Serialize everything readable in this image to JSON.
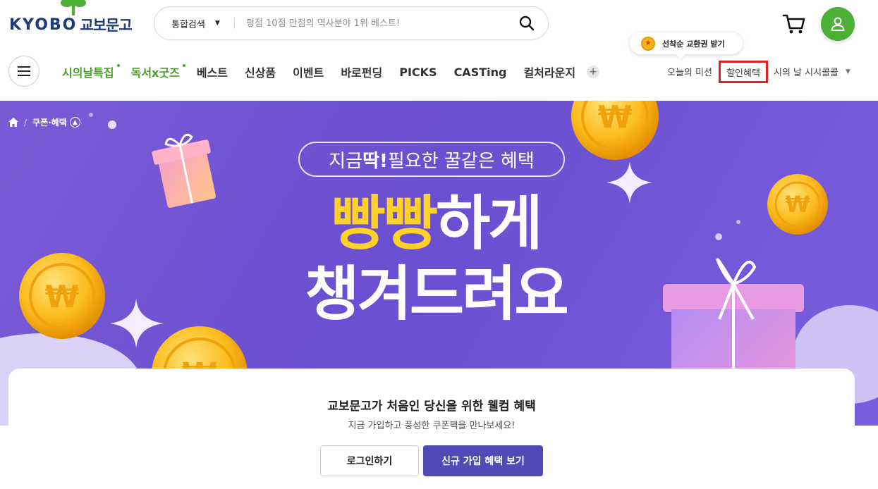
{
  "logo": {
    "en": "KYOBO",
    "ko": "교보문고"
  },
  "search": {
    "category": "통합검색",
    "placeholder": "평점 10점 만점의 역사분야 1위 베스트!"
  },
  "tooltip": {
    "label": "선착순 교환권 받기"
  },
  "nav": {
    "items": [
      "시의날특집",
      "독서x굿즈",
      "베스트",
      "신상품",
      "이벤트",
      "바로펀딩",
      "PICKS",
      "CASTing",
      "컬처라운지"
    ],
    "plus": "+"
  },
  "util": {
    "mission": "오늘의 미션",
    "discount": "할인혜택",
    "promo": "시의 날 시시콜콜"
  },
  "breadcrumb": {
    "label": "쿠폰·혜택",
    "sep": "/"
  },
  "banner": {
    "pill_prefix": "지금 ",
    "pill_bold": "딱!",
    "pill_suffix": " 필요한 꿀같은 혜택",
    "headline_yellow": "빵빵",
    "headline_white": "하게",
    "headline2": "챙겨드려요"
  },
  "welcome": {
    "title": "교보문고가 처음인 당신을 위한 웰컴 혜택",
    "subtitle": "지금 가입하고 풍성한 쿠폰팩을 만나보세요!",
    "login": "로그인하기",
    "join": "신규 가입 혜택 보기"
  },
  "colors": {
    "brand_green": "#4caf36",
    "brand_navy": "#1d3a7a",
    "banner_purple": "#6a4fd0",
    "highlight_red": "#e11d2a",
    "join_button": "#4e4bb6"
  }
}
